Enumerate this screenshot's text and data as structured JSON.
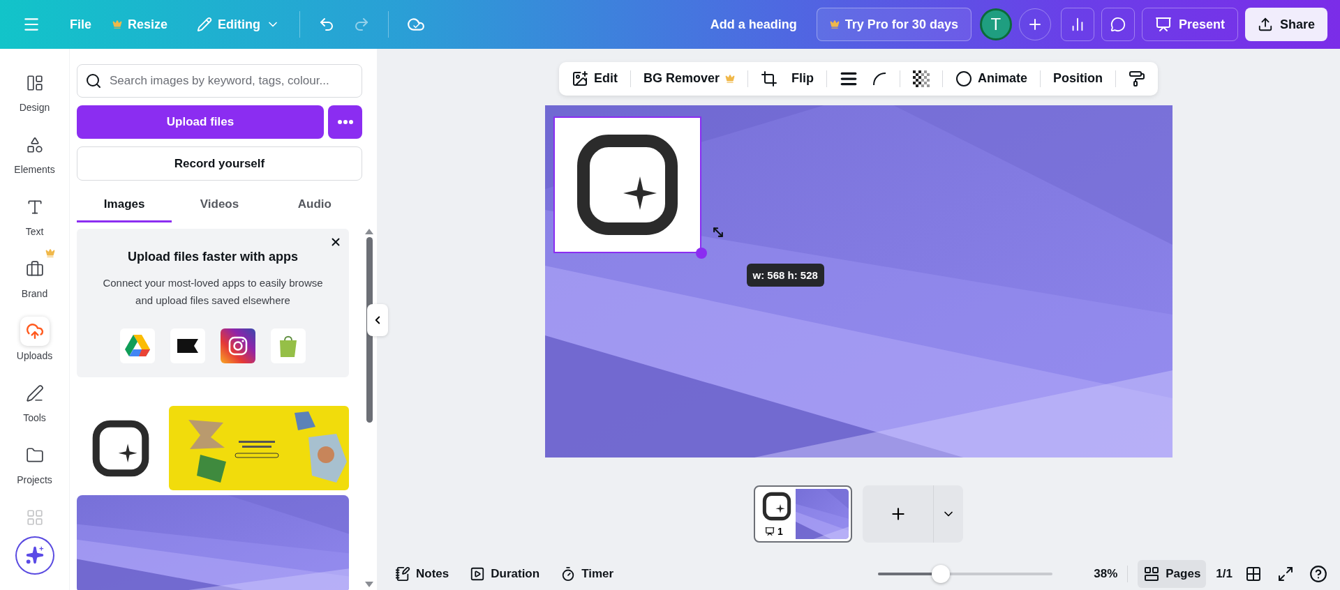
{
  "topbar": {
    "file_label": "File",
    "resize_label": "Resize",
    "mode_label": "Editing",
    "title": "Add a heading",
    "pro_label": "Try Pro for 30 days",
    "avatar_initial": "T",
    "present_label": "Present",
    "share_label": "Share"
  },
  "rail": [
    {
      "kind": "design",
      "label": "Design",
      "selected": false
    },
    {
      "kind": "elements",
      "label": "Elements",
      "selected": false
    },
    {
      "kind": "text",
      "label": "Text",
      "selected": false
    },
    {
      "kind": "brand",
      "label": "Brand",
      "selected": false
    },
    {
      "kind": "uploads",
      "label": "Uploads",
      "selected": true
    },
    {
      "kind": "tools",
      "label": "Tools",
      "selected": false
    },
    {
      "kind": "projects",
      "label": "Projects",
      "selected": false
    },
    {
      "kind": "apps",
      "selected": false
    }
  ],
  "panel": {
    "search_placeholder": "Search images by keyword, tags, colour...",
    "upload_label": "Upload files",
    "record_label": "Record yourself",
    "tabs": [
      {
        "label": "Images",
        "selected": true
      },
      {
        "label": "Videos",
        "selected": false
      },
      {
        "label": "Audio",
        "selected": false
      }
    ],
    "promo": {
      "title": "Upload files faster with apps",
      "body": "Connect your most-loved apps to easily browse and upload files saved elsewhere"
    }
  },
  "toolbar": {
    "edit_label": "Edit",
    "bg_remover_label": "BG Remover",
    "flip_label": "Flip",
    "animate_label": "Animate",
    "position_label": "Position"
  },
  "canvas": {
    "size_tooltip": "w: 568 h: 528"
  },
  "pages": [
    {
      "number": "1",
      "selected": true
    }
  ],
  "bottom": {
    "notes_label": "Notes",
    "duration_label": "Duration",
    "timer_label": "Timer",
    "zoom": {
      "level": 0.36,
      "reading": "38%"
    },
    "pages_label": "Pages",
    "pages_selected": true,
    "page_count": "1/1"
  }
}
